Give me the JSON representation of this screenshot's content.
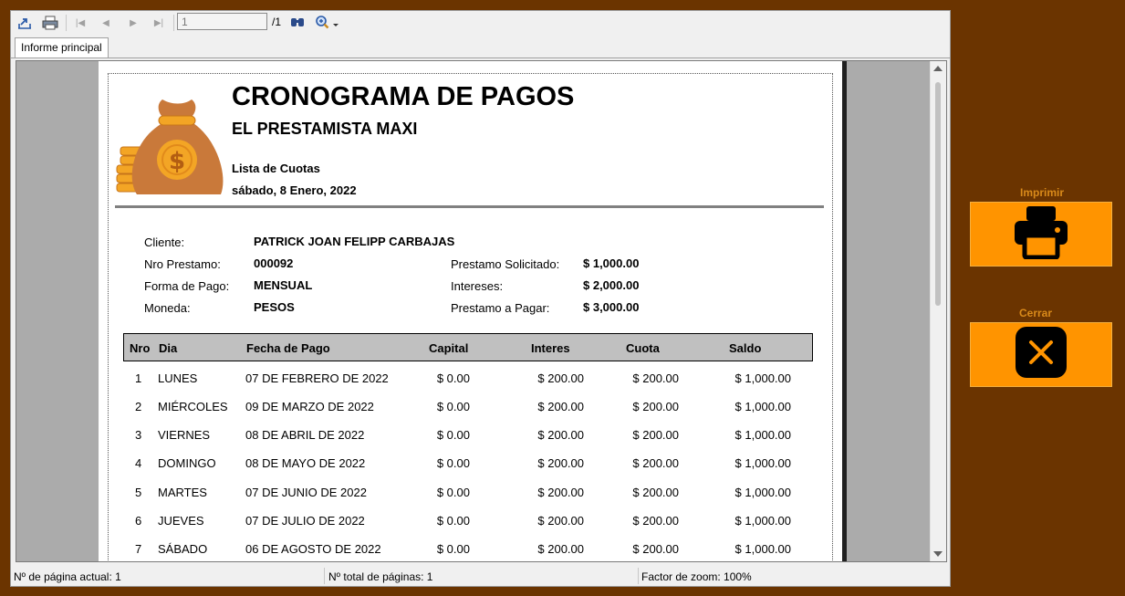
{
  "toolbar": {
    "page_value": "1",
    "page_total": "/1"
  },
  "tab": {
    "label": "Informe principal"
  },
  "report": {
    "title": "CRONOGRAMA DE PAGOS",
    "company": "EL PRESTAMISTA MAXI",
    "list_title": "Lista de Cuotas",
    "date": "sábado, 8 Enero, 2022",
    "client_label": "Cliente:",
    "client_value": "PATRICK JOAN FELIPP CARBAJAS",
    "loan_no_label": "Nro Prestamo:",
    "loan_no_value": "000092",
    "payment_label": "Forma de Pago:",
    "payment_value": "MENSUAL",
    "currency_label": "Moneda:",
    "currency_value": "PESOS",
    "requested_label": "Prestamo Solicitado:",
    "requested_value": "$ 1,000.00",
    "interest_label": "Intereses:",
    "interest_value": "$ 2,000.00",
    "topay_label": "Prestamo a Pagar:",
    "topay_value": "$ 3,000.00",
    "columns": [
      "Nro",
      "Dia",
      "Fecha de Pago",
      "Capital",
      "Interes",
      "Cuota",
      "Saldo"
    ],
    "rows": [
      [
        "1",
        "LUNES",
        "07 DE FEBRERO DE 2022",
        "$ 0.00",
        "$ 200.00",
        "$ 200.00",
        "$ 1,000.00"
      ],
      [
        "2",
        "MIÉRCOLES",
        "09 DE MARZO DE 2022",
        "$ 0.00",
        "$ 200.00",
        "$ 200.00",
        "$ 1,000.00"
      ],
      [
        "3",
        "VIERNES",
        "08 DE ABRIL DE 2022",
        "$ 0.00",
        "$ 200.00",
        "$ 200.00",
        "$ 1,000.00"
      ],
      [
        "4",
        "DOMINGO",
        "08 DE MAYO DE 2022",
        "$ 0.00",
        "$ 200.00",
        "$ 200.00",
        "$ 1,000.00"
      ],
      [
        "5",
        "MARTES",
        "07 DE JUNIO DE 2022",
        "$ 0.00",
        "$ 200.00",
        "$ 200.00",
        "$ 1,000.00"
      ],
      [
        "6",
        "JUEVES",
        "07 DE JULIO DE 2022",
        "$ 0.00",
        "$ 200.00",
        "$ 200.00",
        "$ 1,000.00"
      ],
      [
        "7",
        "SÁBADO",
        "06 DE AGOSTO DE 2022",
        "$ 0.00",
        "$ 200.00",
        "$ 200.00",
        "$ 1,000.00"
      ]
    ]
  },
  "statusbar": {
    "current_page": "Nº de página actual: 1",
    "total_pages": "Nº total de páginas: 1",
    "zoom": "Factor de zoom: 100%"
  },
  "side": {
    "print_label": "Imprimir",
    "close_label": "Cerrar"
  },
  "icons": {
    "toolbar": [
      "export-icon",
      "print-icon",
      "first-page-icon",
      "previous-page-icon",
      "next-page-icon",
      "last-page-icon",
      "find-icon",
      "zoom-icon"
    ],
    "report_logo": "money-bag-icon",
    "side": [
      "printer-icon",
      "close-icon"
    ]
  },
  "colors": {
    "background": "#6b3400",
    "accent_button": "#ff9400",
    "button_label": "#d98a1a",
    "table_header": "#c0c0c0"
  }
}
